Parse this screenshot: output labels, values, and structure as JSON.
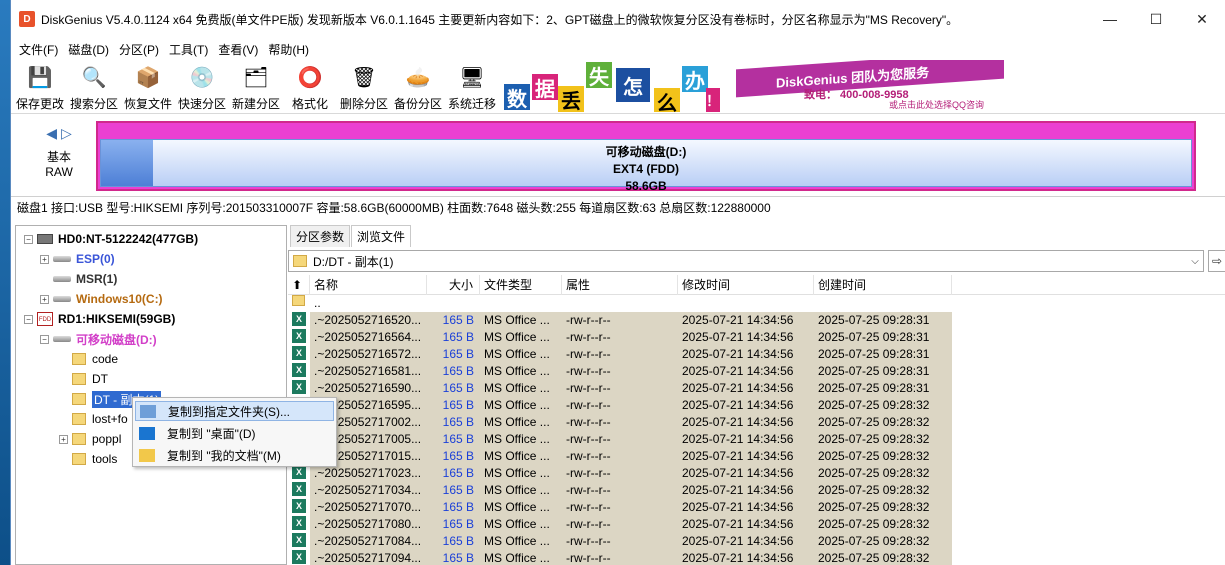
{
  "window": {
    "title": "DiskGenius V5.4.0.1124 x64 免费版(单文件PE版)    发现新版本 V6.0.1.1645 主要更新内容如下：2、GPT磁盘上的微软恢复分区没有卷标时，分区名称显示为\"MS Recovery\"。",
    "app_icon": "D",
    "minimize": "—",
    "maximize": "☐",
    "close": "✕"
  },
  "menu": [
    "文件(F)",
    "磁盘(D)",
    "分区(P)",
    "工具(T)",
    "查看(V)",
    "帮助(H)"
  ],
  "toolbar": [
    {
      "label": "保存更改",
      "icon": "save-icon",
      "glyph": "💾"
    },
    {
      "label": "搜索分区",
      "icon": "search-partition-icon",
      "glyph": "🔍"
    },
    {
      "label": "恢复文件",
      "icon": "recover-files-icon",
      "glyph": "📦"
    },
    {
      "label": "快速分区",
      "icon": "quick-partition-icon",
      "glyph": "💿"
    },
    {
      "label": "新建分区",
      "icon": "new-partition-icon",
      "glyph": "🗂"
    },
    {
      "label": "格式化",
      "icon": "format-icon",
      "glyph": "⭕"
    },
    {
      "label": "删除分区",
      "icon": "delete-partition-icon",
      "glyph": "🗑"
    },
    {
      "label": "备份分区",
      "icon": "backup-partition-icon",
      "glyph": "🥧"
    },
    {
      "label": "系统迁移",
      "icon": "system-migration-icon",
      "glyph": "🖥"
    }
  ],
  "banner": {
    "chars": [
      "数",
      "据",
      "丢",
      "失",
      "怎",
      "么",
      "办",
      "！"
    ],
    "slogan": "DiskGenius 团队为您服务",
    "phone": "致电： 400-008-9958",
    "qq": "或点击此处选择QQ咨询"
  },
  "disk_nav": {
    "type_line1": "基本",
    "type_line2": "RAW"
  },
  "diskbar": {
    "name": "可移动磁盘(D:)",
    "fs": "EXT4 (FDD)",
    "size": "58.6GB"
  },
  "diskinfo": "磁盘1 接口:USB  型号:HIKSEMI  序列号:201503310007F  容量:58.6GB(60000MB)  柱面数:7648  磁头数:255  每道扇区数:63  总扇区数:122880000",
  "tree": {
    "hd0": "HD0:NT-5122242(477GB)",
    "esp": "ESP(0)",
    "msr": "MSR(1)",
    "win": "Windows10(C:)",
    "rd1": "RD1:HIKSEMI(59GB)",
    "removable": "可移动磁盘(D:)",
    "code": "code",
    "dt": "DT",
    "dt_copy": "DT - 副本(1)",
    "lostfound": "lost+fo",
    "poppler": "poppl",
    "tools": "tools"
  },
  "context_menu": {
    "item1": "复制到指定文件夹(S)...",
    "item2": "复制到 \"桌面\"(D)",
    "item3": "复制到 \"我的文档\"(M)"
  },
  "tabs": [
    "分区参数",
    "浏览文件"
  ],
  "path": "D:/DT - 副本(1)",
  "columns": [
    "名称",
    "大小",
    "文件类型",
    "属性",
    "修改时间",
    "创建时间"
  ],
  "parent_row": "..",
  "files": [
    {
      "name": ".~2025052716520...",
      "size": "165 B",
      "type": "MS Office ...",
      "attr": "-rw-r--r--",
      "mtime": "2025-07-21 14:34:56",
      "ctime": "2025-07-25 09:28:31"
    },
    {
      "name": ".~2025052716564...",
      "size": "165 B",
      "type": "MS Office ...",
      "attr": "-rw-r--r--",
      "mtime": "2025-07-21 14:34:56",
      "ctime": "2025-07-25 09:28:31"
    },
    {
      "name": ".~2025052716572...",
      "size": "165 B",
      "type": "MS Office ...",
      "attr": "-rw-r--r--",
      "mtime": "2025-07-21 14:34:56",
      "ctime": "2025-07-25 09:28:31"
    },
    {
      "name": ".~2025052716581...",
      "size": "165 B",
      "type": "MS Office ...",
      "attr": "-rw-r--r--",
      "mtime": "2025-07-21 14:34:56",
      "ctime": "2025-07-25 09:28:31"
    },
    {
      "name": ".~2025052716590...",
      "size": "165 B",
      "type": "MS Office ...",
      "attr": "-rw-r--r--",
      "mtime": "2025-07-21 14:34:56",
      "ctime": "2025-07-25 09:28:31"
    },
    {
      "name": ".~2025052716595...",
      "size": "165 B",
      "type": "MS Office ...",
      "attr": "-rw-r--r--",
      "mtime": "2025-07-21 14:34:56",
      "ctime": "2025-07-25 09:28:32"
    },
    {
      "name": ".~2025052717002...",
      "size": "165 B",
      "type": "MS Office ...",
      "attr": "-rw-r--r--",
      "mtime": "2025-07-21 14:34:56",
      "ctime": "2025-07-25 09:28:32"
    },
    {
      "name": ".~2025052717005...",
      "size": "165 B",
      "type": "MS Office ...",
      "attr": "-rw-r--r--",
      "mtime": "2025-07-21 14:34:56",
      "ctime": "2025-07-25 09:28:32"
    },
    {
      "name": ".~2025052717015...",
      "size": "165 B",
      "type": "MS Office ...",
      "attr": "-rw-r--r--",
      "mtime": "2025-07-21 14:34:56",
      "ctime": "2025-07-25 09:28:32"
    },
    {
      "name": ".~2025052717023...",
      "size": "165 B",
      "type": "MS Office ...",
      "attr": "-rw-r--r--",
      "mtime": "2025-07-21 14:34:56",
      "ctime": "2025-07-25 09:28:32"
    },
    {
      "name": ".~2025052717034...",
      "size": "165 B",
      "type": "MS Office ...",
      "attr": "-rw-r--r--",
      "mtime": "2025-07-21 14:34:56",
      "ctime": "2025-07-25 09:28:32"
    },
    {
      "name": ".~2025052717070...",
      "size": "165 B",
      "type": "MS Office ...",
      "attr": "-rw-r--r--",
      "mtime": "2025-07-21 14:34:56",
      "ctime": "2025-07-25 09:28:32"
    },
    {
      "name": ".~2025052717080...",
      "size": "165 B",
      "type": "MS Office ...",
      "attr": "-rw-r--r--",
      "mtime": "2025-07-21 14:34:56",
      "ctime": "2025-07-25 09:28:32"
    },
    {
      "name": ".~2025052717084...",
      "size": "165 B",
      "type": "MS Office ...",
      "attr": "-rw-r--r--",
      "mtime": "2025-07-21 14:34:56",
      "ctime": "2025-07-25 09:28:32"
    },
    {
      "name": ".~2025052717094...",
      "size": "165 B",
      "type": "MS Office ...",
      "attr": "-rw-r--r--",
      "mtime": "2025-07-21 14:34:56",
      "ctime": "2025-07-25 09:28:32"
    }
  ]
}
